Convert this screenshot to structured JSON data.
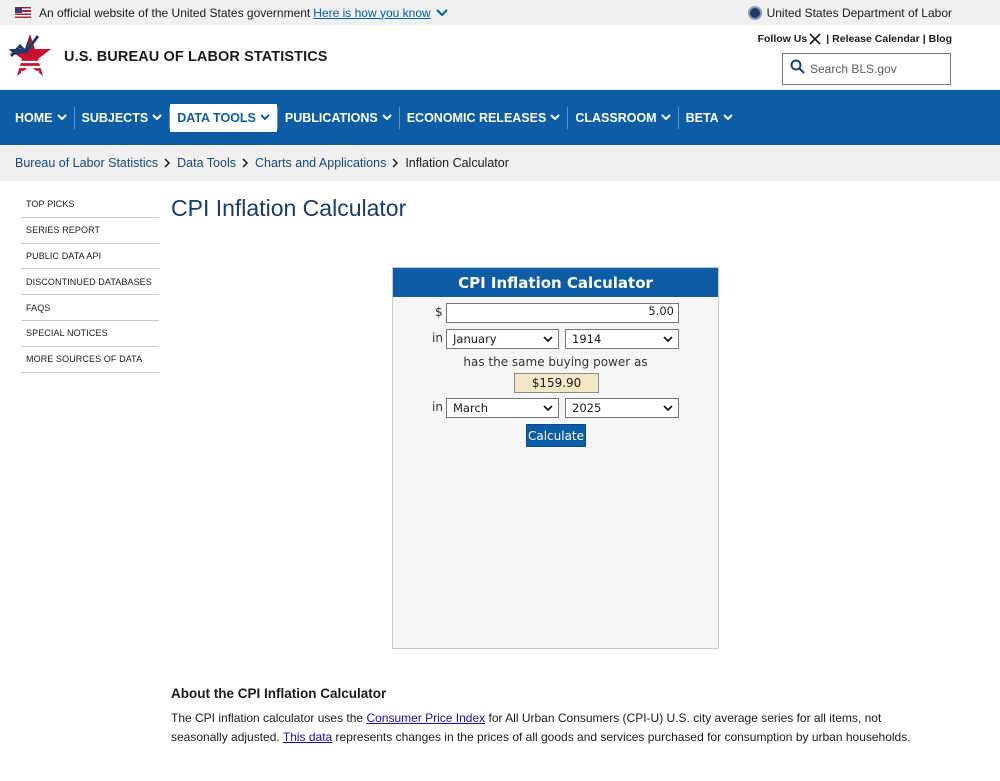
{
  "gov_banner": {
    "text": "An official website of the United States government",
    "link": "Here is how you know",
    "department": "United States Department of Labor"
  },
  "header": {
    "title": "U.S. BUREAU OF LABOR STATISTICS",
    "follow_us": "Follow Us",
    "release_calendar": "Release Calendar",
    "blog": "Blog",
    "search_placeholder": "Search BLS.gov"
  },
  "nav": {
    "items": [
      {
        "label": "HOME"
      },
      {
        "label": "SUBJECTS"
      },
      {
        "label": "DATA TOOLS"
      },
      {
        "label": "PUBLICATIONS"
      },
      {
        "label": "ECONOMIC RELEASES"
      },
      {
        "label": "CLASSROOM"
      },
      {
        "label": "BETA"
      }
    ],
    "active": "DATA TOOLS"
  },
  "breadcrumb": {
    "items": [
      "Bureau of Labor Statistics",
      "Data Tools",
      "Charts and Applications"
    ],
    "current": "Inflation Calculator"
  },
  "sidebar": {
    "items": [
      {
        "label": "TOP PICKS"
      },
      {
        "label": "SERIES REPORT"
      },
      {
        "label": "PUBLIC DATA API"
      },
      {
        "label": "DISCONTINUED DATABASES"
      },
      {
        "label": "FAQS"
      },
      {
        "label": "SPECIAL NOTICES"
      },
      {
        "label": "MORE SOURCES OF DATA"
      }
    ]
  },
  "page_title": "CPI Inflation Calculator",
  "calculator": {
    "title": "CPI Inflation Calculator",
    "currency_symbol": "$",
    "amount": "5.00",
    "in_label": "in",
    "from_month": "January",
    "from_year": "1914",
    "same_power_text": "has the same buying power as",
    "result": "$159.90",
    "to_month": "March",
    "to_year": "2025",
    "button_label": "Calculate"
  },
  "about": {
    "title": "About the CPI Inflation Calculator",
    "text_1": "The CPI inflation calculator uses the ",
    "link_1": "Consumer Price Index",
    "text_2": " for All Urban Consumers (CPI-U) U.S. city average series for all items, not seasonally adjusted. ",
    "link_2": "This data",
    "text_3": " represents changes in the prices of all goods and services purchased for consumption by urban households."
  },
  "colors": {
    "nav_blue": "#0c5da5",
    "result_bg": "#f3e7c5"
  }
}
